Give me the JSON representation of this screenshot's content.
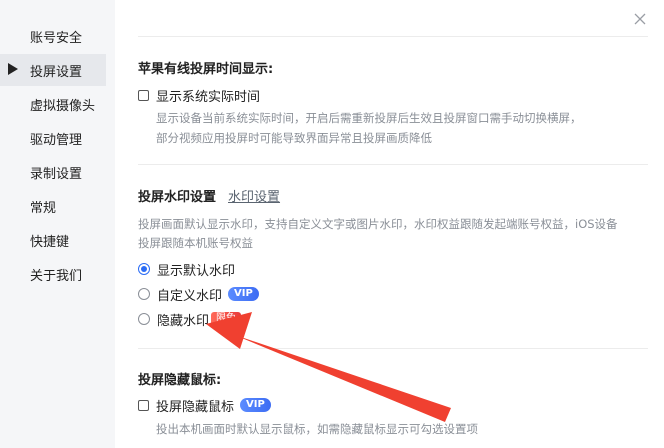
{
  "sidebar": {
    "items": [
      {
        "label": "账号安全",
        "active": false
      },
      {
        "label": "投屏设置",
        "active": true
      },
      {
        "label": "虚拟摄像头",
        "active": false
      },
      {
        "label": "驱动管理",
        "active": false
      },
      {
        "label": "录制设置",
        "active": false
      },
      {
        "label": "常规",
        "active": false
      },
      {
        "label": "快捷键",
        "active": false
      },
      {
        "label": "关于我们",
        "active": false
      }
    ]
  },
  "wired_time": {
    "title": "苹果有线投屏时间显示:",
    "checkbox_label": "显示系统实际时间",
    "checked": false,
    "desc_line1": "显示设备当前系统实际时间，开启后需重新投屏后生效且投屏窗口需手动切换横屏，",
    "desc_line2": "部分视频应用投屏时可能导致界面异常且投屏画质降低"
  },
  "watermark": {
    "title": "投屏水印设置",
    "settings_link": "水印设置",
    "desc_line1": "投屏画面默认显示水印，支持自定义文字或图片水印，水印权益跟随发起端账号权益，iOS设备",
    "desc_line2": "投屏跟随本机账号权益",
    "options": [
      {
        "label": "显示默认水印",
        "checked": true
      },
      {
        "label": "自定义水印",
        "badge": "VIP",
        "checked": false
      },
      {
        "label": "隐藏水印",
        "badge": "限免",
        "checked": false
      }
    ]
  },
  "mouse": {
    "title": "投屏隐藏鼠标:",
    "checkbox_label": "投屏隐藏鼠标",
    "badge": "VIP",
    "checked": false,
    "desc": "投出本机画面时默认显示鼠标，如需隐藏鼠标显示可勾选设置项"
  },
  "colors": {
    "accent": "#2b6cf5",
    "annotation_arrow": "#f04030",
    "sidebar_bg": "#f5f6f8"
  }
}
